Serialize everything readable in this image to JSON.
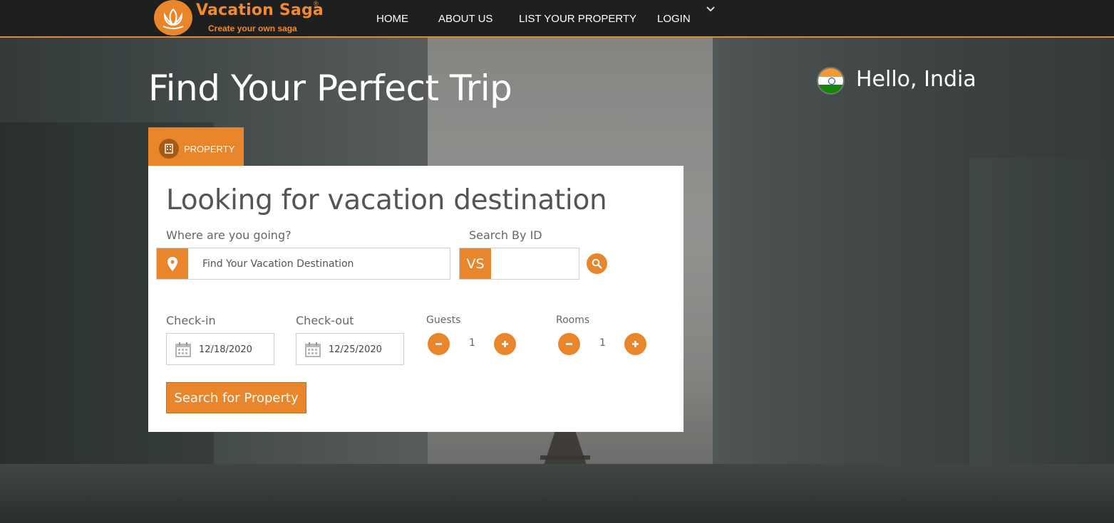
{
  "brand": {
    "name": "Vacation Saga",
    "registered": "®",
    "tagline": "Create your own saga"
  },
  "nav": {
    "items": [
      "HOME",
      "ABOUT US",
      "LIST YOUR PROPERTY",
      "LOGIN"
    ]
  },
  "hero": {
    "headline": "Find Your Perfect Trip",
    "greeting": "Hello, India"
  },
  "tabs": [
    {
      "label": "PROPERTY",
      "active": true
    }
  ],
  "search": {
    "title": "Looking for vacation destination",
    "destination_label": "Where are you going?",
    "destination_placeholder": "Find Your Vacation Destination",
    "id_label": "Search By ID",
    "id_prefix": "VS",
    "checkin_label": "Check-in",
    "checkin_value": "12/18/2020",
    "checkout_label": "Check-out",
    "checkout_value": "12/25/2020",
    "guests_label": "Guests",
    "guests_value": "1",
    "rooms_label": "Rooms",
    "rooms_value": "1",
    "submit_label": "Search for Property"
  },
  "colors": {
    "accent": "#e9852a",
    "nav_bg": "#1f1f1f",
    "card_bg": "#ffffff"
  },
  "icons": [
    "lotus-logo-icon",
    "chevron-down-icon",
    "india-flag-icon",
    "building-icon",
    "map-pin-icon",
    "search-icon",
    "calendar-icon",
    "minus-icon",
    "plus-icon"
  ]
}
